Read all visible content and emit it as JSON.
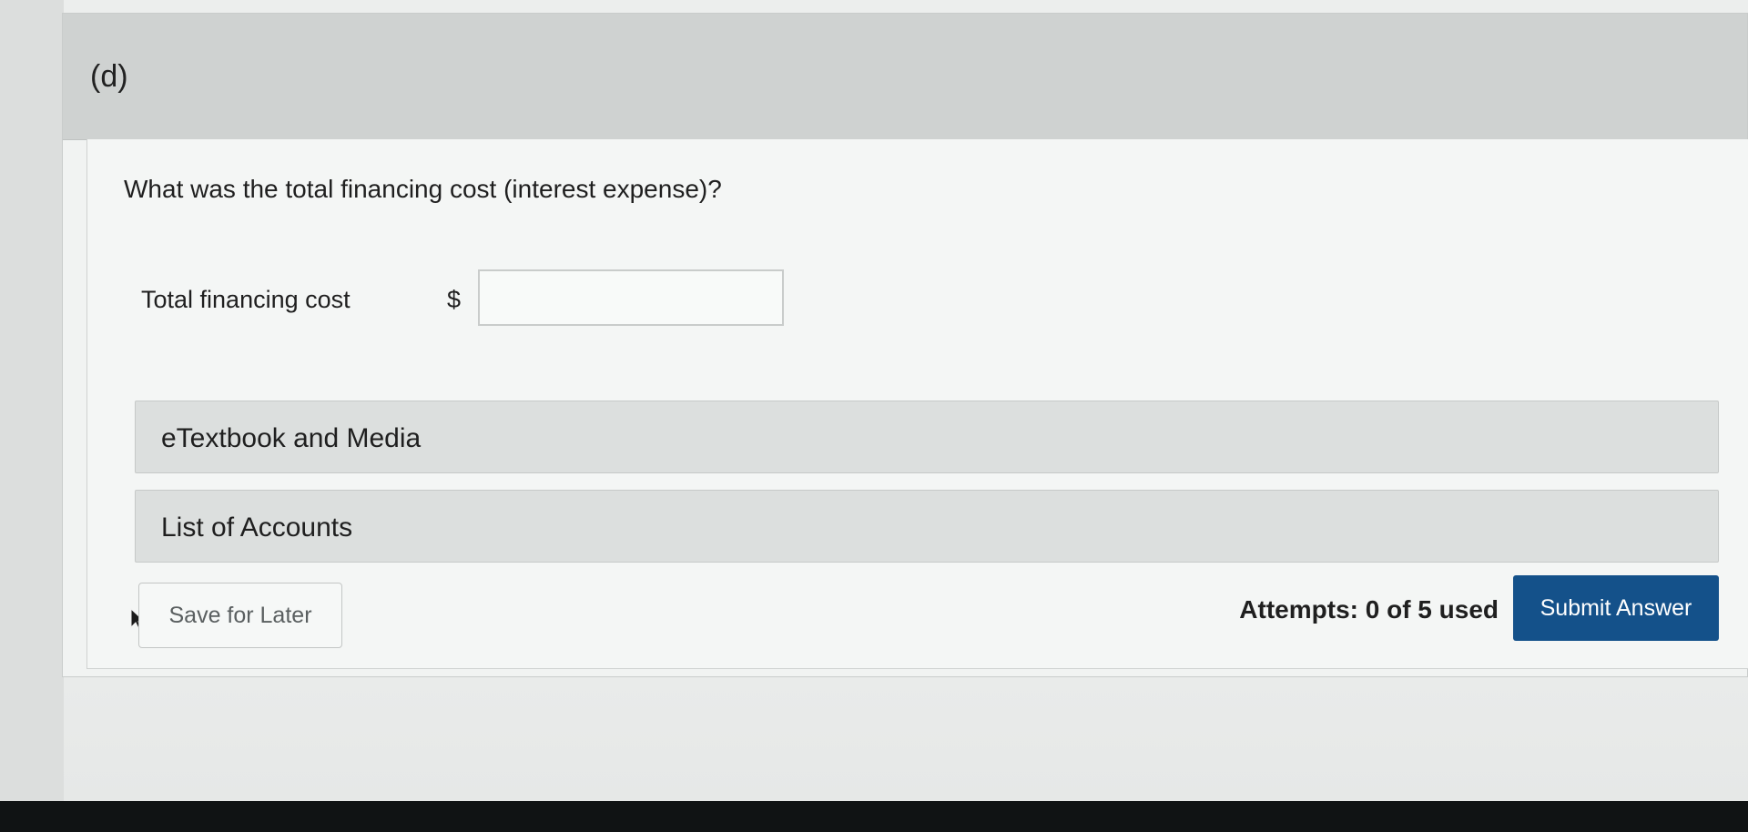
{
  "part": {
    "label": "(d)"
  },
  "question": {
    "text": "What was the total financing cost (interest expense)?"
  },
  "answer_field": {
    "label": "Total financing cost",
    "currency_symbol": "$",
    "value": "",
    "placeholder": ""
  },
  "accordions": [
    {
      "label": "eTextbook and Media"
    },
    {
      "label": "List of Accounts"
    }
  ],
  "footer": {
    "save_label": "Save for Later",
    "attempts_text": "Attempts: 0 of 5 used",
    "submit_label": "Submit Answer"
  },
  "colors": {
    "submit_button": "#14518a",
    "header_band": "#cfd2d1"
  },
  "icons": {
    "cursor": "mouse-pointer-icon"
  }
}
